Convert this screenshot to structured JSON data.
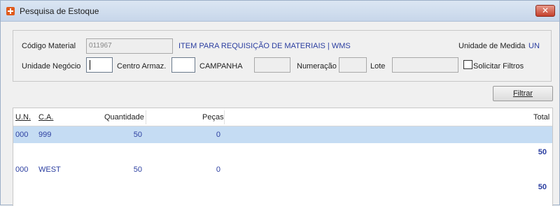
{
  "window": {
    "title": "Pesquisa de Estoque",
    "close_label": "✕"
  },
  "form": {
    "codigo_material_label": "Código Material",
    "codigo_material_value": "011967",
    "material_description": "ITEM PARA REQUISIÇÃO DE MATERIAIS | WMS",
    "unidade_medida_label": "Unidade de Medida",
    "unidade_medida_value": "UN",
    "unidade_negocio_label": "Unidade Negócio",
    "unidade_negocio_value": "",
    "centro_armaz_label": "Centro Armaz.",
    "centro_armaz_value": "",
    "campanha_label": "CAMPANHA",
    "campanha_value": "",
    "numeracao_label": "Numeração",
    "numeracao_value": "",
    "lote_label": "Lote",
    "lote_value": "",
    "solicitar_filtros_label": "Solicitar Filtros",
    "solicitar_filtros_checked": false
  },
  "filter_button": {
    "label": "Filtrar"
  },
  "grid": {
    "headers": {
      "un": "U.N.",
      "ca": "C.A.",
      "quantidade": "Quantidade",
      "pecas": "Peças",
      "total": "Total"
    },
    "rows": [
      {
        "un": "000",
        "ca": "999",
        "quantidade": "50",
        "pecas": "0",
        "selected": true
      },
      {
        "un": "000",
        "ca": "WEST",
        "quantidade": "50",
        "pecas": "0",
        "selected": false
      }
    ],
    "totals": [
      "50",
      "50"
    ]
  },
  "colors": {
    "accent_text": "#2b3ea0",
    "selected_row": "#c5dcf3",
    "close_button": "#c5402c"
  }
}
